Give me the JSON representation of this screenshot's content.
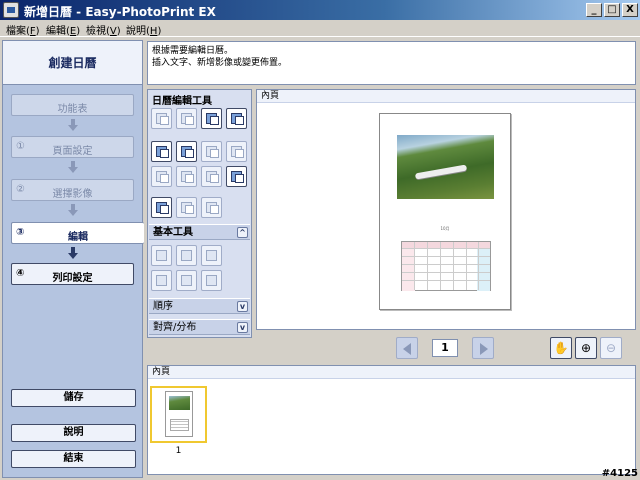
{
  "window": {
    "title": "新增日曆 - Easy-PhotoPrint EX",
    "minimize": "_",
    "maximize": "□",
    "close": "X"
  },
  "menu": [
    {
      "label": "檔案(",
      "key": "F",
      "end": ")"
    },
    {
      "label": "編輯(",
      "key": "E",
      "end": ")"
    },
    {
      "label": "檢視(",
      "key": "V",
      "end": ")"
    },
    {
      "label": "說明(",
      "key": "H",
      "end": ")"
    }
  ],
  "sidebar": {
    "header": "創建日曆",
    "steps": [
      {
        "num": "",
        "label": "功能表",
        "state": "disabled"
      },
      {
        "num": "①",
        "label": "頁面設定",
        "state": "disabled"
      },
      {
        "num": "②",
        "label": "選擇影像",
        "state": "disabled"
      },
      {
        "num": "③",
        "label": "編輯",
        "state": "active"
      },
      {
        "num": "④",
        "label": "列印設定",
        "state": "enabled"
      }
    ],
    "save": "儲存",
    "help": "說明",
    "exit": "結束"
  },
  "instructions": {
    "line1": "根據需要編輯日曆。",
    "line2": "插入文字、新增影像或變更佈置。"
  },
  "tools": {
    "title": "日曆編輯工具",
    "basic": "基本工具",
    "order": "順序",
    "align": "對齊/分布"
  },
  "content": {
    "title": "內頁",
    "month": "10月",
    "page_number": "1"
  },
  "thumbnails": {
    "title": "內頁",
    "items": [
      {
        "number": "1"
      }
    ]
  },
  "stamp": "#4125",
  "colors": {
    "accent": "#0a246a",
    "panel": "#b4c4e0",
    "thumb_selected": "#f0c830"
  }
}
